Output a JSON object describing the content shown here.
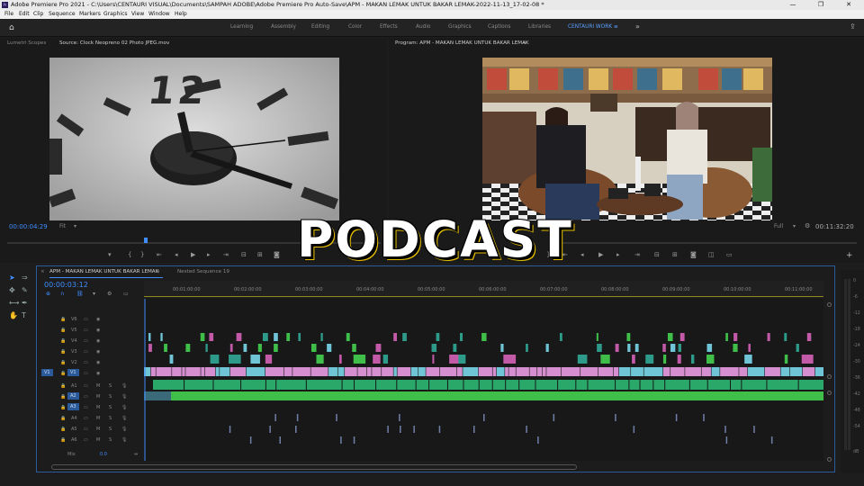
{
  "window": {
    "title": "Adobe Premiere Pro 2021 - C:\\Users\\CENTAURI VISUAL\\Documents\\SAMPAH ADOBE\\Adobe Premiere Pro Auto-Save\\APM - MAKAN LEMAK UNTUK BAKAR LEMAK-2022-11-13_17-02-08 *",
    "app_icon_label": "Pr",
    "minimize": "—",
    "maximize": "❐",
    "close": "✕"
  },
  "menu": [
    "File",
    "Edit",
    "Clip",
    "Sequence",
    "Markers",
    "Graphics",
    "View",
    "Window",
    "Help"
  ],
  "workspaces": {
    "items": [
      "Learning",
      "Assembly",
      "Editing",
      "Color",
      "Effects",
      "Audio",
      "Graphics",
      "Captions",
      "Libraries",
      "CENTAURI WORK"
    ],
    "active": "CENTAURI WORK",
    "active_menu_glyph": "≡",
    "more": "»"
  },
  "source_panel": {
    "tabs": [
      "Lumetri Scopes",
      "Source: Clock Neopreno 02 Photo JPEG.mov"
    ],
    "active_tab": "Source: Clock Neopreno 02 Photo JPEG.mov",
    "timecode": "00:00:04:29",
    "fit": "Fit",
    "clock_numeral": "12"
  },
  "program_panel": {
    "tab": "Program: APM - MAKAN LEMAK UNTUK BAKAR LEMAK",
    "timecode_right": "00:11:32:20",
    "zoom": "Full"
  },
  "overlay": {
    "title": "PODCAST"
  },
  "timeline": {
    "tabs": [
      "APM - MAKAN LEMAK UNTUK BAKAR LEMAK",
      "Nested Sequence 19"
    ],
    "playhead_tc": "00:00:03:12",
    "ruler": [
      "00:01:00:00",
      "00:02:00:00",
      "00:03:00:00",
      "00:04:00:00",
      "00:05:00:00",
      "00:06:00:00",
      "00:07:00:00",
      "00:08:00:00",
      "00:09:00:00",
      "00:10:00:00",
      "00:11:00:00"
    ],
    "video_tracks": [
      "V6",
      "V5",
      "V4",
      "V3",
      "V2",
      "V1"
    ],
    "audio_tracks": [
      "A1",
      "A2",
      "A3",
      "A4",
      "A5",
      "A6"
    ],
    "track_flags": {
      "mute": "M",
      "solo": "S"
    },
    "mix_label": "Mix",
    "mix_value": "0.0",
    "source_patch_v": "V1",
    "target_patch_v": "V1"
  },
  "meter_scale": [
    "0",
    "-6",
    "-12",
    "-18",
    "-24",
    "-30",
    "-36",
    "-42",
    "-48",
    "-54",
    "dB"
  ],
  "colors": {
    "accent": "#3f8dff",
    "clip_video": "#d58fd0",
    "clip_video_alt": "#c25aa8",
    "clip_teal": "#2e9a8a",
    "clip_green": "#3fbf4a",
    "clip_audio": "#2aa86a",
    "clip_cyan": "#6fc4d6"
  }
}
